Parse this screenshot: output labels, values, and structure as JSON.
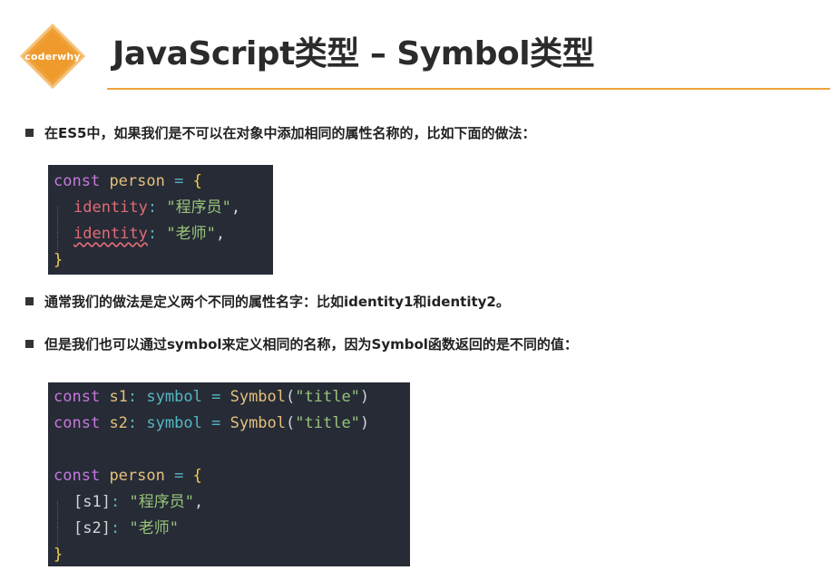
{
  "brand": {
    "logo_text": "coderwhy",
    "accent": "#f0a23a"
  },
  "title": "JavaScript类型 – Symbol类型",
  "bullets": [
    "在ES5中，如果我们是不可以在对象中添加相同的属性名称的，比如下面的做法：",
    "通常我们的做法是定义两个不同的属性名字：比如identity1和identity2。",
    "但是我们也可以通过symbol来定义相同的名称，因为Symbol函数返回的是不同的值："
  ],
  "code1": {
    "kw": "const",
    "name": "person",
    "eq": "=",
    "open": "{",
    "prop1": "identity",
    "val1": "\"程序员\"",
    "prop2": "identity",
    "val2": "\"老师\"",
    "close": "}"
  },
  "code2": {
    "kw": "const",
    "s1": "s1",
    "s2": "s2",
    "type": "symbol",
    "eq": "=",
    "fn": "Symbol",
    "arg": "\"title\"",
    "name": "person",
    "open": "{",
    "key1": "[s1]",
    "val1": "\"程序员\"",
    "key2": "[s2]",
    "val2": "\"老师\"",
    "close": "}"
  }
}
